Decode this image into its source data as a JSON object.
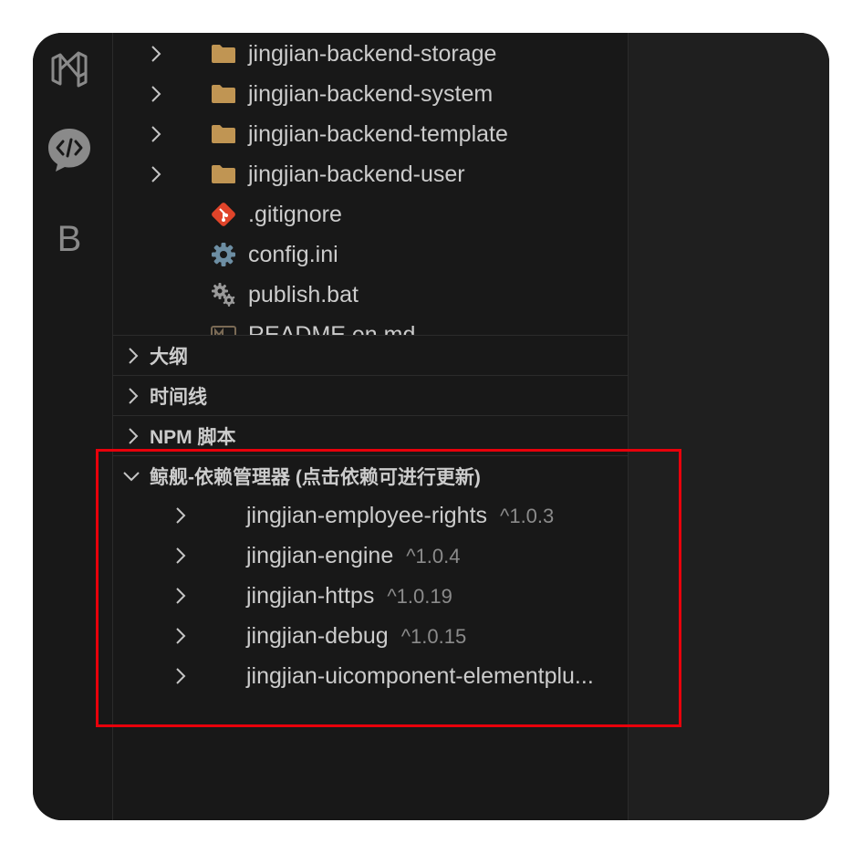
{
  "explorer": {
    "items": [
      {
        "label": "jingjian-backend-storage",
        "icon": "folder-icon",
        "expandable": true
      },
      {
        "label": "jingjian-backend-system",
        "icon": "folder-icon",
        "expandable": true
      },
      {
        "label": "jingjian-backend-template",
        "icon": "folder-icon",
        "expandable": true
      },
      {
        "label": "jingjian-backend-user",
        "icon": "folder-icon",
        "expandable": true
      },
      {
        "label": ".gitignore",
        "icon": "git-icon",
        "expandable": false
      },
      {
        "label": "config.ini",
        "icon": "gear-icon",
        "expandable": false
      },
      {
        "label": "publish.bat",
        "icon": "gears-icon",
        "expandable": false
      },
      {
        "label": "README.en.md",
        "icon": "markdown-icon",
        "expandable": false
      }
    ]
  },
  "sections": {
    "outline": "大纲",
    "timeline": "时间线",
    "npm_scripts": "NPM 脚本",
    "dependency_manager": "鲸舰-依赖管理器 (点击依赖可进行更新)"
  },
  "dependencies": [
    {
      "name": "jingjian-employee-rights",
      "version": "^1.0.3"
    },
    {
      "name": "jingjian-engine",
      "version": "^1.0.4"
    },
    {
      "name": "jingjian-https",
      "version": "^1.0.19"
    },
    {
      "name": "jingjian-debug",
      "version": "^1.0.15"
    },
    {
      "name": "jingjian-uicomponent-elementplu...",
      "version": ""
    }
  ],
  "activitybar": {
    "icons": [
      "visual-studio-icon",
      "code-chat-icon",
      "b-letter-icon"
    ],
    "b_letter": "B"
  },
  "colors": {
    "background": "#181818",
    "text": "#cccccc",
    "folder": "#c09553",
    "git": "#e0442a",
    "gear": "#6d8ea3",
    "highlight_box": "#e8000b"
  }
}
